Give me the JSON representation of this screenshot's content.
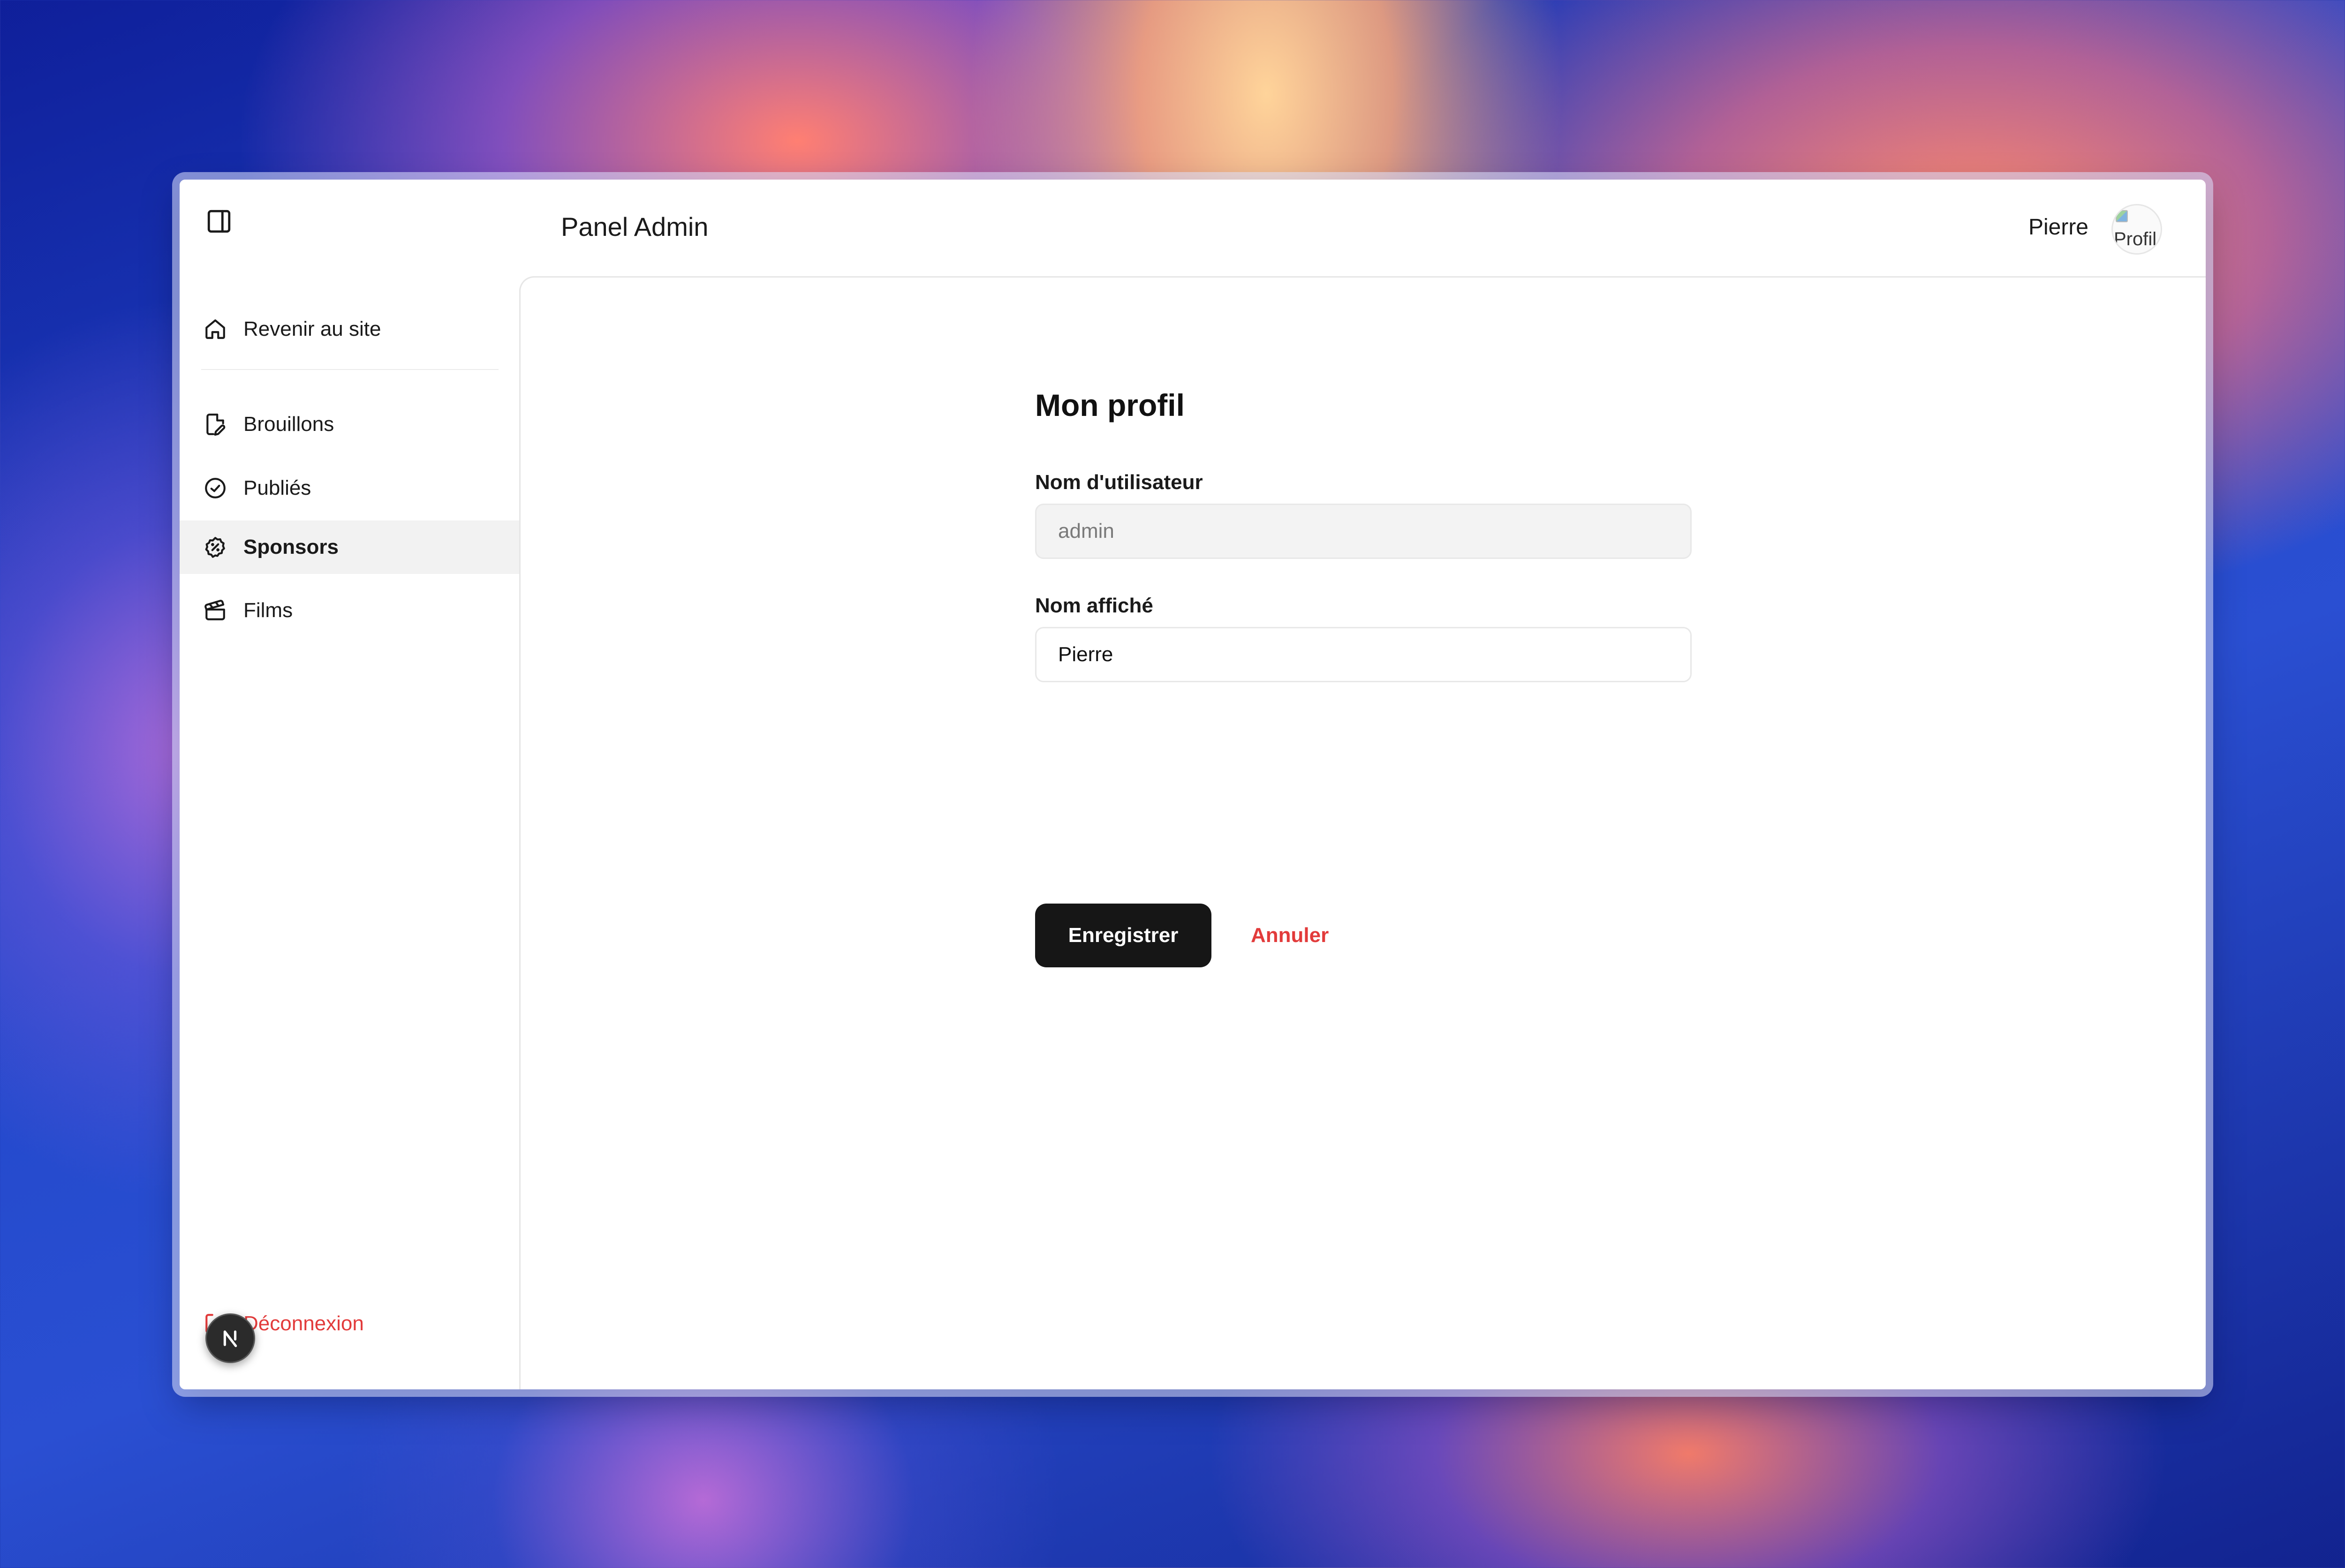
{
  "header": {
    "title": "Panel Admin",
    "user_name": "Pierre",
    "avatar_alt": "Profil"
  },
  "sidebar": {
    "home": {
      "label": "Revenir au site",
      "icon": "home-icon"
    },
    "items": [
      {
        "label": "Brouillons",
        "icon": "file-edit-icon",
        "active": false
      },
      {
        "label": "Publiés",
        "icon": "check-circle-icon",
        "active": false
      },
      {
        "label": "Sponsors",
        "icon": "badge-percent-icon",
        "active": true
      },
      {
        "label": "Films",
        "icon": "clapperboard-icon",
        "active": false
      }
    ],
    "logout_label": "Déconnexion"
  },
  "form": {
    "title": "Mon profil",
    "username": {
      "label": "Nom d'utilisateur",
      "value": "admin"
    },
    "display_name": {
      "label": "Nom affiché",
      "value": "Pierre"
    },
    "save_label": "Enregistrer",
    "cancel_label": "Annuler"
  },
  "colors": {
    "accent_danger": "#e23b3b",
    "primary_button": "#161616",
    "active_item_bg": "#f2f2f2"
  }
}
